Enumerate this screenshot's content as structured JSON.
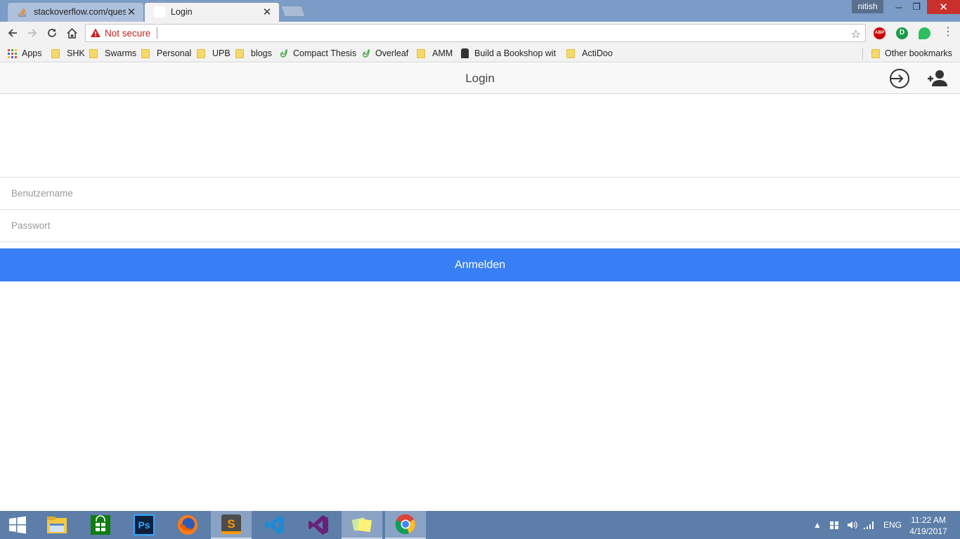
{
  "browser": {
    "tabs": [
      {
        "title": "stackoverflow.com/quest",
        "active": false
      },
      {
        "title": "Login",
        "active": true
      }
    ],
    "profile_name": "nitish",
    "window_controls": {
      "minimize": "─",
      "restore": "❐",
      "close": "✕"
    },
    "address_bar": {
      "security_label": "Not secure",
      "url": ""
    },
    "bookmarks": [
      {
        "label": "Apps",
        "icon": "apps-grid-icon"
      },
      {
        "label": "SHK",
        "icon": "folder-icon"
      },
      {
        "label": "Swarms",
        "icon": "folder-icon"
      },
      {
        "label": "Personal",
        "icon": "folder-icon"
      },
      {
        "label": "UPB",
        "icon": "folder-icon"
      },
      {
        "label": "blogs",
        "icon": "folder-icon"
      },
      {
        "label": "Compact Thesis",
        "icon": "overleaf-icon"
      },
      {
        "label": "Overleaf",
        "icon": "overleaf-icon"
      },
      {
        "label": "AMM",
        "icon": "folder-icon"
      },
      {
        "label": "Build a Bookshop with",
        "icon": "bookshop-icon"
      },
      {
        "label": "ActiDoo",
        "icon": "folder-icon"
      },
      {
        "label": "Other bookmarks",
        "icon": "folder-icon"
      }
    ],
    "extensions": [
      "adblock-plus-icon",
      "extension-d-icon",
      "evernote-icon"
    ]
  },
  "page": {
    "title": "Login",
    "username_placeholder": "Benutzername",
    "password_placeholder": "Passwort",
    "submit_label": "Anmelden"
  },
  "taskbar": {
    "apps": [
      "start-icon",
      "file-explorer-icon",
      "store-icon",
      "photoshop-icon",
      "firefox-icon",
      "sublime-text-icon",
      "vscode-icon",
      "visual-studio-icon",
      "sticky-notes-icon",
      "chrome-icon"
    ],
    "language": "ENG",
    "time": "11:22 AM",
    "date": "4/19/2017"
  },
  "colors": {
    "primary": "#387ef5",
    "tabstrip": "#7a9cc7",
    "taskbar": "#5c7ea9"
  }
}
